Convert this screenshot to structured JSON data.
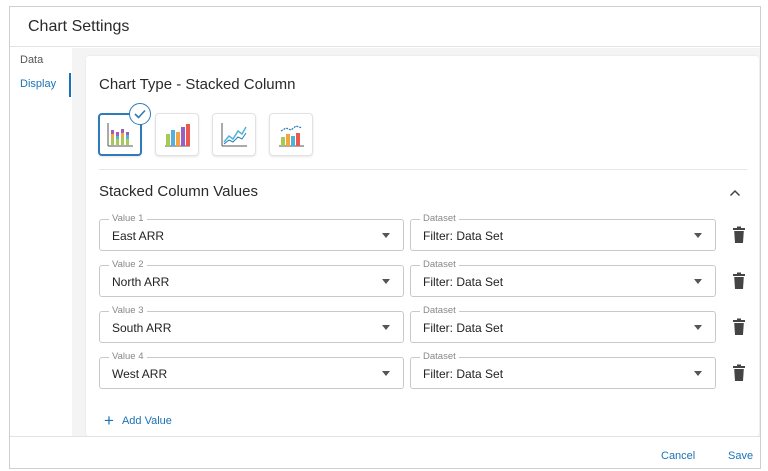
{
  "dialog": {
    "title": "Chart Settings"
  },
  "nav": {
    "items": [
      {
        "label": "Data",
        "active": false
      },
      {
        "label": "Display",
        "active": true
      }
    ]
  },
  "chart_type": {
    "title": "Chart Type - Stacked Column",
    "options": [
      {
        "icon": "stacked-column-chart-icon",
        "selected": true
      },
      {
        "icon": "column-chart-icon",
        "selected": false
      },
      {
        "icon": "line-chart-icon",
        "selected": false
      },
      {
        "icon": "combo-chart-icon",
        "selected": false
      }
    ]
  },
  "values_section": {
    "title": "Stacked Column Values",
    "rows": [
      {
        "value_label": "Value 1",
        "value": "East ARR",
        "dataset_label": "Dataset",
        "dataset": "Filter: Data Set"
      },
      {
        "value_label": "Value 2",
        "value": "North ARR",
        "dataset_label": "Dataset",
        "dataset": "Filter: Data Set"
      },
      {
        "value_label": "Value 3",
        "value": "South ARR",
        "dataset_label": "Dataset",
        "dataset": "Filter: Data Set"
      },
      {
        "value_label": "Value 4",
        "value": "West ARR",
        "dataset_label": "Dataset",
        "dataset": "Filter: Data Set"
      }
    ],
    "add_label": "Add Value"
  },
  "footer": {
    "cancel_label": "Cancel",
    "save_label": "Save"
  },
  "colors": {
    "accent": "#1a73b8",
    "selected_border": "#2f7ab8"
  }
}
